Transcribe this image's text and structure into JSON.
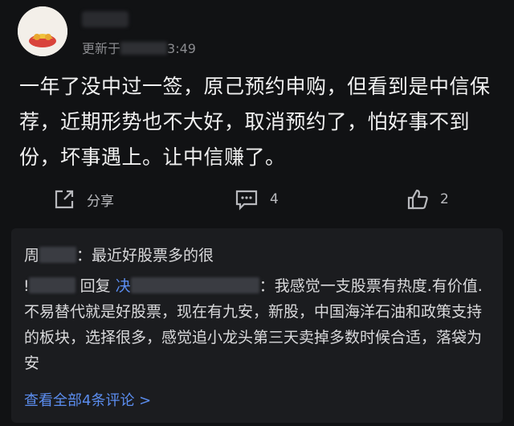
{
  "header": {
    "updated_prefix": "更新于",
    "updated_suffix": "3:49"
  },
  "post": {
    "text": "一年了没中过一签，原己预约申购，但看到是中信保荐，近期形势也不大好，取消预约了，怕好事不到份，坏事遇上。让中信赚了。"
  },
  "actions": {
    "share_label": "分享",
    "comment_count": "4",
    "like_count": "2"
  },
  "replies": {
    "items": [
      {
        "author_partial": "周",
        "text": "：最近好股票多的很"
      },
      {
        "author_partial": "ǃ",
        "reply_word": "回复",
        "target_partial": "决",
        "text": "：我感觉一支股票有热度.有价值.不易替代就是好股票，现在有九安，新股，中国海洋石油和政策支持的板块，选择很多，感觉追小龙头第三天卖掉多数时候合适，落袋为安"
      }
    ],
    "view_all": "查看全部4条评论 >"
  },
  "colors": {
    "background": "#111214",
    "panel": "#1b1c1f",
    "link_blue": "#5b8def"
  }
}
